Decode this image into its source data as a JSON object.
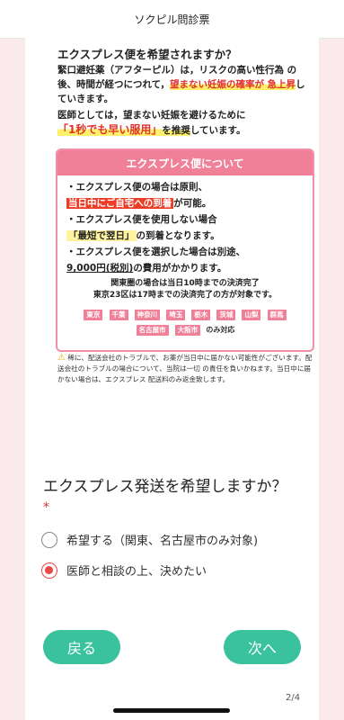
{
  "header": {
    "title": "ソクピル問診票"
  },
  "info": {
    "title": "エクスプレス便を希望されますか？",
    "para1_a": "緊口避妊薬（アフターピル）は，リスクの高い性行為 の後、時間が経つにつれて，",
    "para1_b": "望まない妊娠の確率が 急上昇",
    "para1_c": "していきます。",
    "para2_a": "医師としては，望まない妊娠を避けるために",
    "para2_b": "「1秒でも早い服用」",
    "para2_c": "を推奨",
    "para2_d": "しています。"
  },
  "express_box": {
    "title": "エクスプレス便について",
    "b1_a": "・エクスプレス便の場合は原則、",
    "b1_b": "当日中にご自宅への到着",
    "b1_c": "が可能。",
    "b2_a": "・エクスプレス便を使用しない場合",
    "b2_b": "「最短で翌日」",
    "b2_c": "の到着となります。",
    "b3_a": "・エクスプレス便を選択した場合は別途、",
    "b3_b": "9,000円(税別)",
    "b3_c": "の費用がかかります。",
    "note1": "関東圏の場合は当日10時までの決済完了",
    "note2": "東京23区は17時までの決済完了の方が対象です。",
    "areas": [
      "東京",
      "千葉",
      "神奈川",
      "埼玉",
      "栃木",
      "茨城",
      "山梨",
      "群馬",
      "名古屋市",
      "大阪市"
    ],
    "areas_suffix": "のみ対応"
  },
  "warning": {
    "icon": "warning-icon",
    "text": "稀に、配送会社のトラブルで、お薬が当日中に届かない可能性がございます。配送会社のトラブルの場合について、当院は一切 の責任を負いかねます。当日中に届かない場合は、エクスプレス 配送料のみ返金致します。"
  },
  "question": {
    "label": "エクスプレス発送を希望しますか？",
    "required": "*",
    "options": [
      {
        "label": "希望する（関東、名古屋市のみ対象)",
        "selected": false
      },
      {
        "label": "医師と相談の上、決めたい",
        "selected": true
      }
    ]
  },
  "nav": {
    "back": "戻る",
    "next": "次へ",
    "page": "2/4"
  },
  "colors": {
    "accent": "#39c29d",
    "pink": "#f07f98",
    "red": "#e0312f",
    "bg": "#fbeaec"
  }
}
